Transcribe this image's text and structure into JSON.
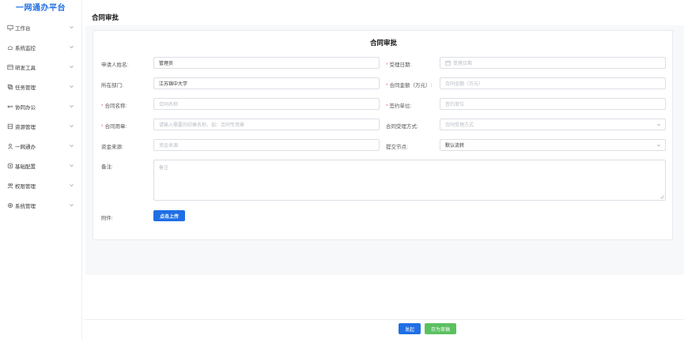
{
  "sidebar": {
    "logo": "一网通办平台",
    "items": [
      {
        "label": "工作台",
        "icon": "monitor-icon"
      },
      {
        "label": "系统监控",
        "icon": "gauge-icon"
      },
      {
        "label": "研发工具",
        "icon": "toolbox-icon"
      },
      {
        "label": "任务管理",
        "icon": "task-icon"
      },
      {
        "label": "协同办公",
        "icon": "share-icon"
      },
      {
        "label": "资源管理",
        "icon": "storage-icon"
      },
      {
        "label": "一网通办",
        "icon": "user-icon"
      },
      {
        "label": "基础配置",
        "icon": "config-icon"
      },
      {
        "label": "权限管理",
        "icon": "permission-icon"
      },
      {
        "label": "系统管理",
        "icon": "gear-icon"
      }
    ]
  },
  "header": {
    "title": "合同审批"
  },
  "form": {
    "title": "合同审批",
    "applicant": {
      "label": "申请人姓名:",
      "value": "管理员"
    },
    "sign_date": {
      "label": "受理日期:",
      "placeholder": "受理日期"
    },
    "department": {
      "label": "所在部门:",
      "value": "江苏锦中大学"
    },
    "amount": {
      "label": "合同金额（万元）:",
      "placeholder": "合同金额（万元）"
    },
    "contract_name": {
      "label": "合同名称:",
      "placeholder": "合同名称"
    },
    "sign_unit": {
      "label": "签约单位:",
      "placeholder": "签约单位"
    },
    "purpose": {
      "label": "合同用章:",
      "placeholder": "请输入需要的印章名称，如：合同专用章"
    },
    "method": {
      "label": "合同受理方式:",
      "placeholder": "合同受理方式"
    },
    "fund_source": {
      "label": "资金来源:",
      "placeholder": "资金来源"
    },
    "submit_node": {
      "label": "提交节点:",
      "value": "默认流转"
    },
    "remark": {
      "label": "备注:",
      "placeholder": "备注"
    },
    "attachment": {
      "label": "附件:",
      "button": "点击上传"
    }
  },
  "footer": {
    "submit": "发起",
    "draft": "存为草稿"
  },
  "colors": {
    "primary": "#1f6fe5",
    "success": "#5bc060",
    "required": "#f56c6c"
  }
}
